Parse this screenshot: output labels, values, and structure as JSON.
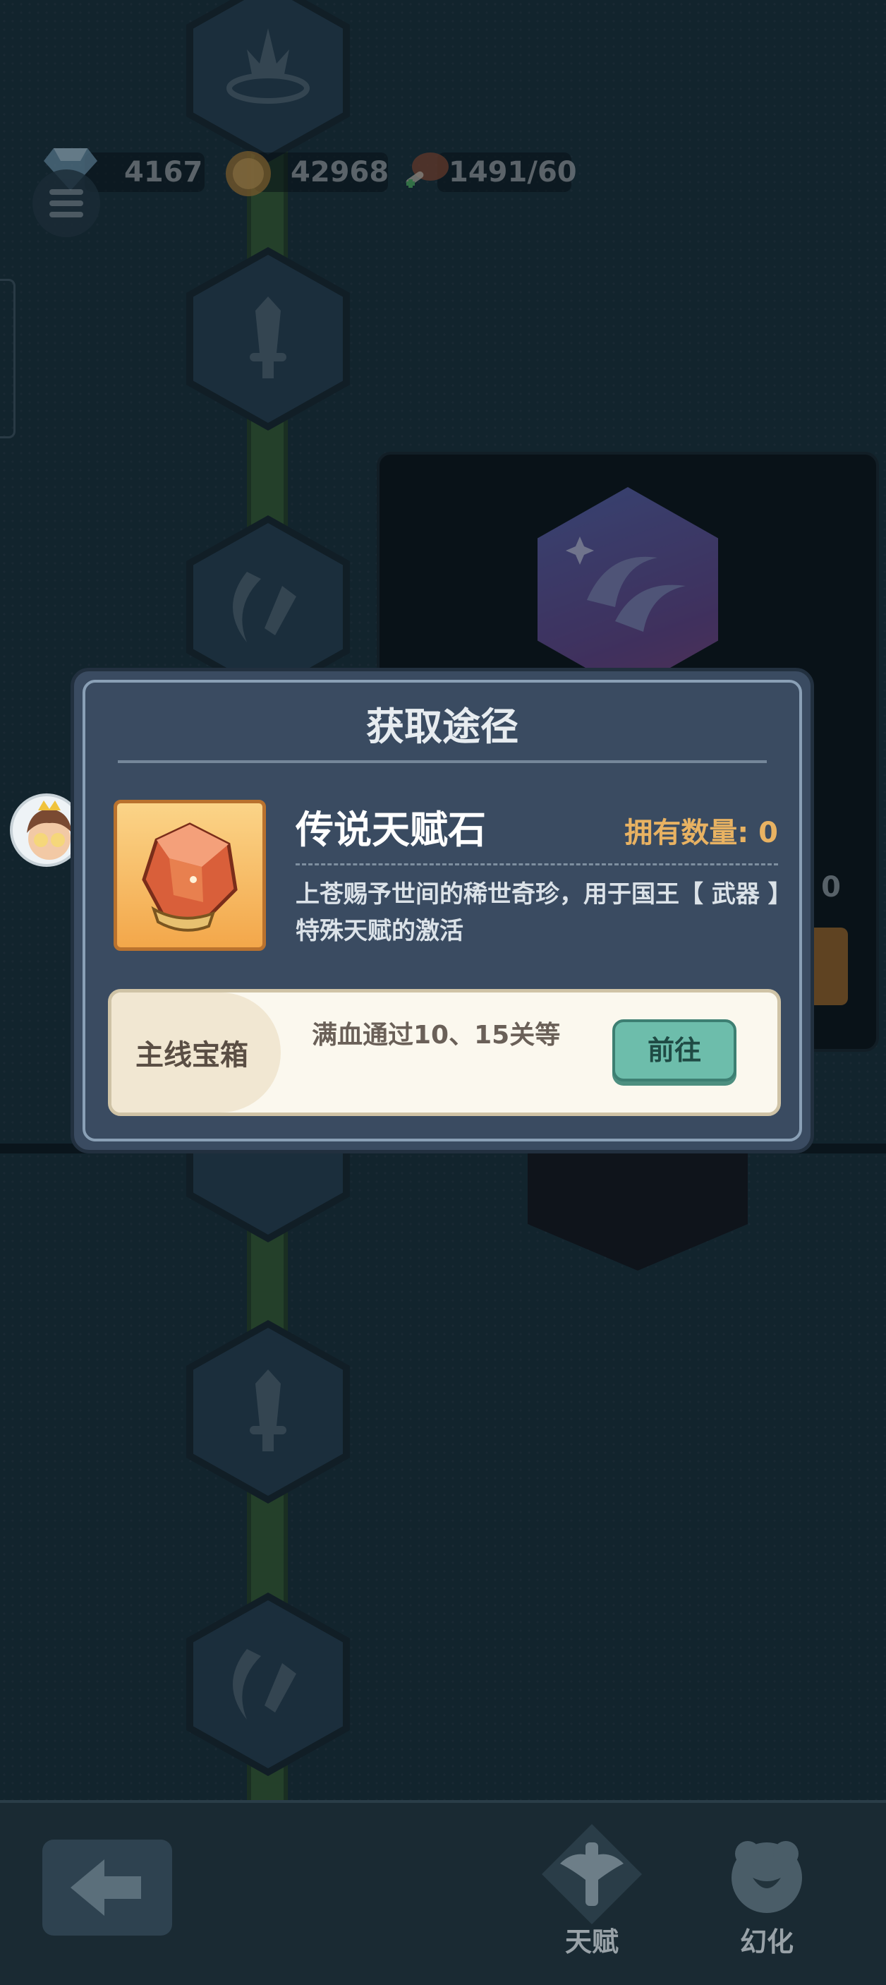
{
  "currencies": [
    {
      "icon": "diamond-icon",
      "value": "4167"
    },
    {
      "icon": "coin-icon",
      "value": "42968"
    },
    {
      "icon": "meat-icon",
      "value": "1491/60"
    }
  ],
  "panel": {
    "partial_text": "0"
  },
  "modal": {
    "title": "获取途径",
    "item_name": "传说天赋石",
    "owned_label": "拥有数量:",
    "owned_count": "0",
    "description": "上苍赐予世间的稀世奇珍，用于国王【 武器 】特殊天赋的激活",
    "route": {
      "source": "主线宝箱",
      "condition": "满血通过10、15关等",
      "button": "前往"
    }
  },
  "bottom_nav": {
    "talent_label": "天赋",
    "illusion_label": "幻化"
  },
  "colors": {
    "accent_go": "#6dbdab",
    "owned": "#e8b262",
    "modal_bg": "#3a4b61"
  }
}
